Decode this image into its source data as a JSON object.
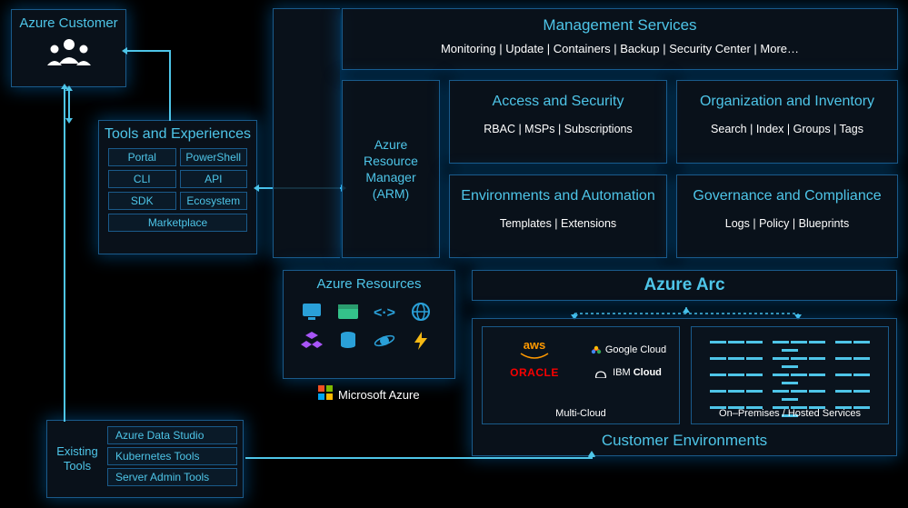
{
  "customer": {
    "label": "Azure Customer"
  },
  "tools_box": {
    "title": "Tools and Experiences",
    "items": [
      "Portal",
      "PowerShell",
      "CLI",
      "API",
      "SDK",
      "Ecosystem",
      "Marketplace"
    ]
  },
  "existing_tools_box": {
    "title": "Existing Tools",
    "items": [
      "Azure Data Studio",
      "Kubernetes Tools",
      "Server Admin Tools"
    ]
  },
  "mgmt_services": {
    "title": "Management Services",
    "subtitle": "Monitoring | Update | Containers | Backup | Security Center | More…"
  },
  "arm": {
    "label": "Azure Resource Manager (ARM)"
  },
  "quad": {
    "access": {
      "title": "Access and Security",
      "sub": "RBAC | MSPs | Subscriptions"
    },
    "org": {
      "title": "Organization and Inventory",
      "sub": "Search | Index | Groups | Tags"
    },
    "env": {
      "title": "Environments and Automation",
      "sub": "Templates | Extensions"
    },
    "gov": {
      "title": "Governance and Compliance",
      "sub": "Logs | Policy | Blueprints"
    }
  },
  "azure_resources": {
    "title": "Azure Resources"
  },
  "ms_azure_label": "Microsoft Azure",
  "azure_arc": {
    "title": "Azure Arc"
  },
  "customer_env": {
    "title": "Customer Environments",
    "multi_cloud": {
      "label": "Multi-Cloud",
      "providers": {
        "aws": "aws",
        "google": "Google Cloud",
        "oracle": "ORACLE",
        "ibm": "IBM Cloud"
      }
    },
    "onprem": {
      "label": "On–Premises / Hosted Services"
    }
  }
}
